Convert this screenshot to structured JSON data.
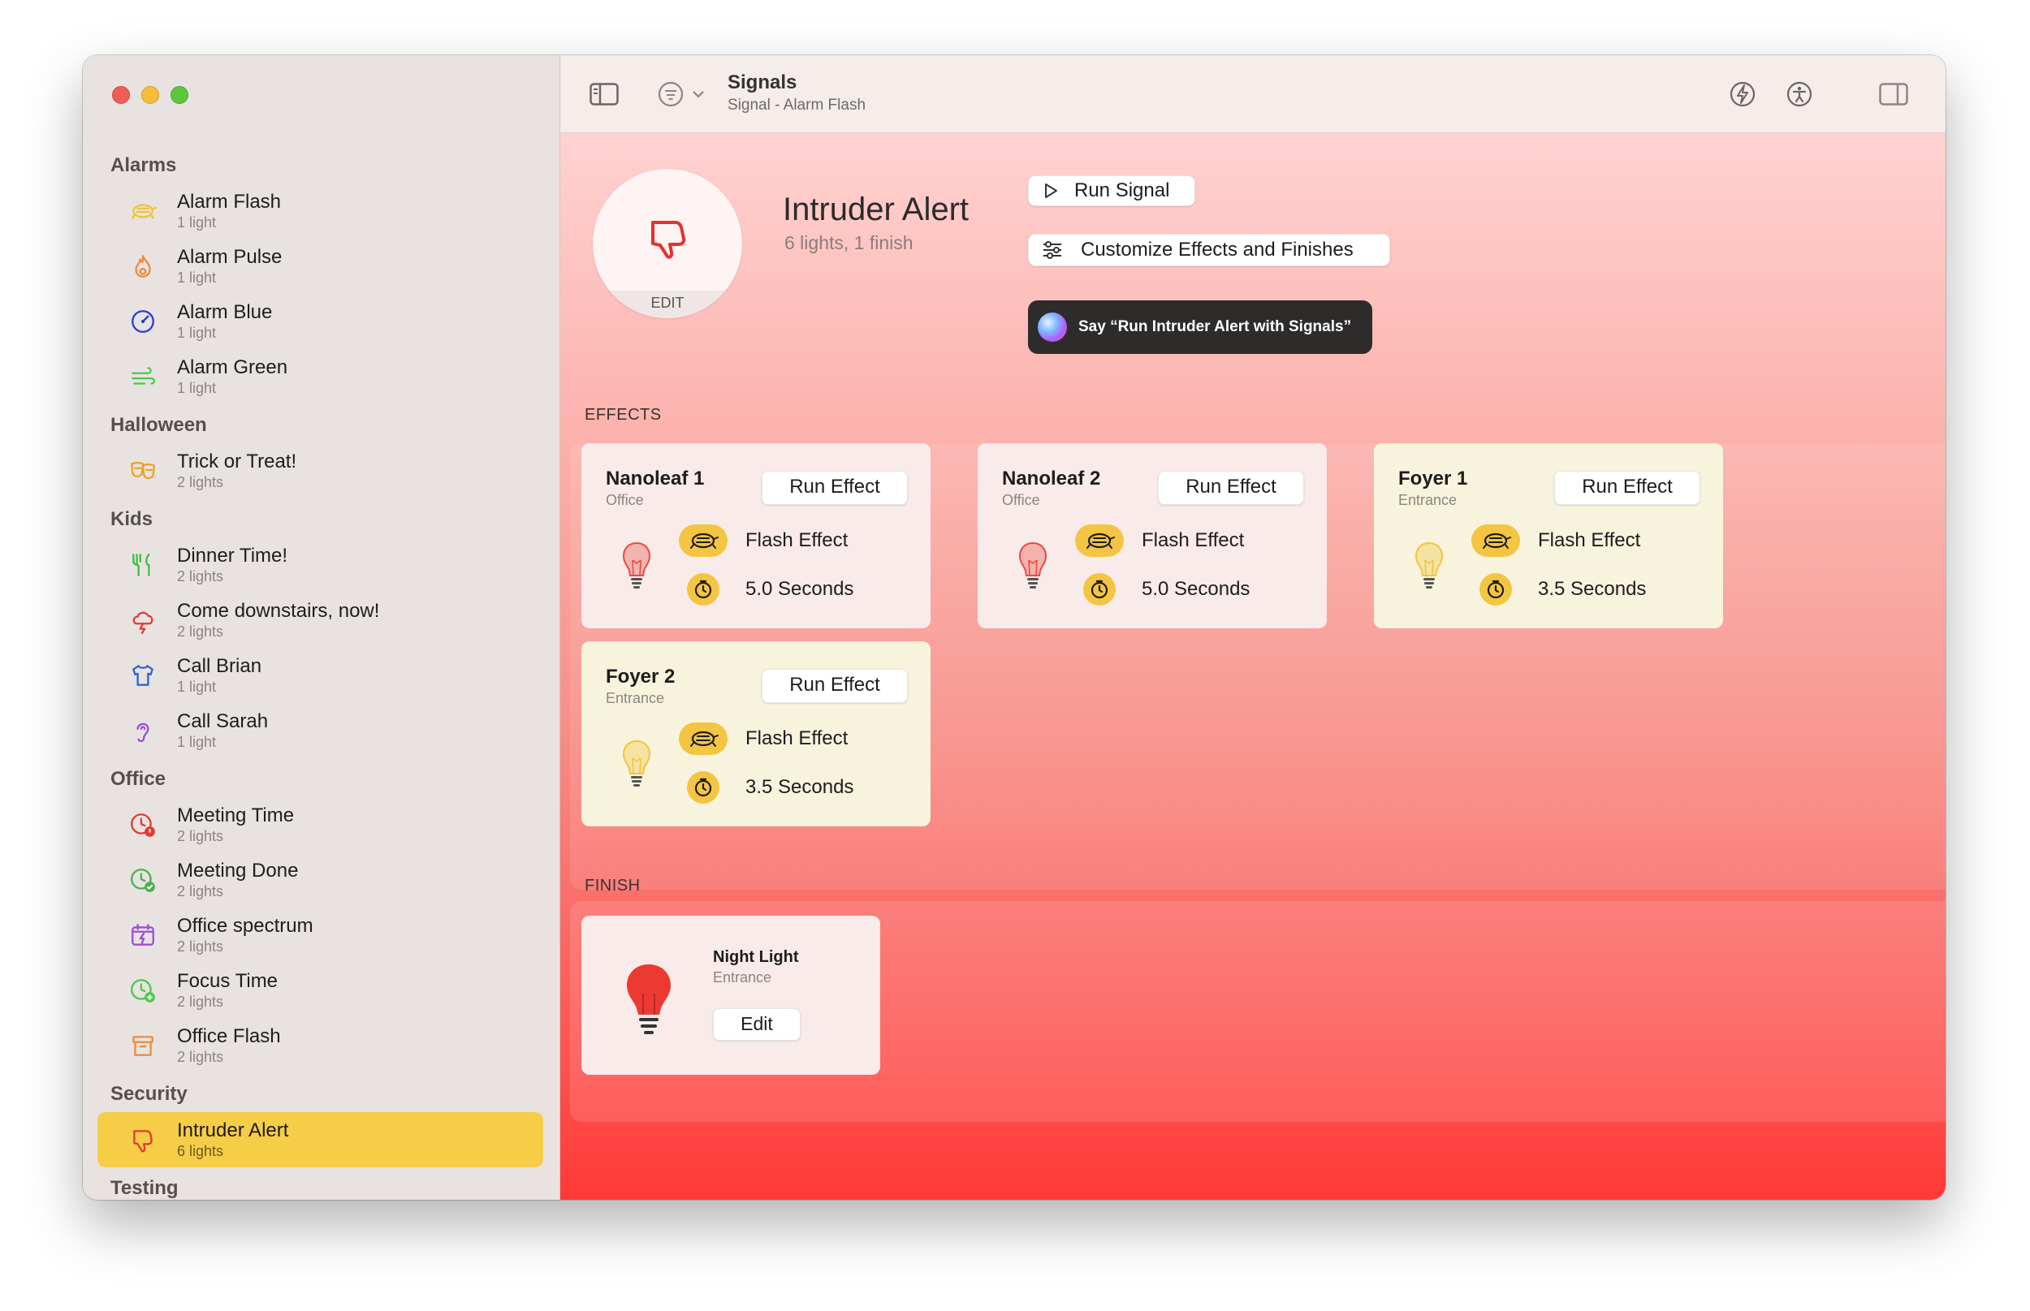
{
  "app": {
    "title": "Signals",
    "subtitle": "Signal - Alarm Flash"
  },
  "sidebar": {
    "groups": [
      {
        "title": "Alarms",
        "items": [
          {
            "name": "Alarm Flash",
            "sub": "1 light",
            "icon": "turtle-icon",
            "color": "#f0c531"
          },
          {
            "name": "Alarm Pulse",
            "sub": "1 light",
            "icon": "flame-icon",
            "color": "#f08a3a"
          },
          {
            "name": "Alarm Blue",
            "sub": "1 light",
            "icon": "gauge-icon",
            "color": "#2a3fd6"
          },
          {
            "name": "Alarm Green",
            "sub": "1 light",
            "icon": "wind-icon",
            "color": "#4cc84a"
          }
        ]
      },
      {
        "title": "Halloween",
        "items": [
          {
            "name": "Trick or Treat!",
            "sub": "2 lights",
            "icon": "theater-masks-icon",
            "color": "#f0a12a"
          }
        ]
      },
      {
        "title": "Kids",
        "items": [
          {
            "name": "Dinner Time!",
            "sub": "2 lights",
            "icon": "fork-knife-icon",
            "color": "#3fbf4a"
          },
          {
            "name": "Come downstairs, now!",
            "sub": "2 lights",
            "icon": "cloud-bolt-icon",
            "color": "#e23b35"
          },
          {
            "name": "Call Brian",
            "sub": "1 light",
            "icon": "tshirt-icon",
            "color": "#2d64d8"
          },
          {
            "name": "Call Sarah",
            "sub": "1 light",
            "icon": "ear-icon",
            "color": "#9b4fd8"
          }
        ]
      },
      {
        "title": "Office",
        "items": [
          {
            "name": "Meeting Time",
            "sub": "2 lights",
            "icon": "clock-alert-icon",
            "color": "#e23b35"
          },
          {
            "name": "Meeting Done",
            "sub": "2 lights",
            "icon": "clock-check-icon",
            "color": "#4caf50"
          },
          {
            "name": "Office spectrum",
            "sub": "2 lights",
            "icon": "calendar-bolt-icon",
            "color": "#9b4fd8"
          },
          {
            "name": "Focus Time",
            "sub": "2 lights",
            "icon": "clock-plus-icon",
            "color": "#4cc84a"
          },
          {
            "name": "Office Flash",
            "sub": "2 lights",
            "icon": "archive-box-icon",
            "color": "#f08a3a"
          }
        ]
      },
      {
        "title": "Security",
        "items": [
          {
            "name": "Intruder Alert",
            "sub": "6 lights",
            "icon": "thumbs-down-icon",
            "color": "#e23b35",
            "selected": true
          }
        ]
      },
      {
        "title": "Testing",
        "items": []
      }
    ]
  },
  "signal": {
    "title": "Intruder Alert",
    "summary": "6 lights, 1 finish",
    "edit_label": "EDIT",
    "run_label": "Run Signal",
    "customize_label": "Customize Effects and Finishes",
    "siri_label": "Say “Run Intruder Alert with Signals”"
  },
  "effects": {
    "label": "EFFECTS",
    "cards": [
      {
        "name": "Nanoleaf 1",
        "room": "Office",
        "run": "Run Effect",
        "effect": "Flash Effect",
        "duration": "5.0 Seconds",
        "bulb_color": "#ec4a43",
        "tone": "red"
      },
      {
        "name": "Nanoleaf 2",
        "room": "Office",
        "run": "Run Effect",
        "effect": "Flash Effect",
        "duration": "5.0 Seconds",
        "bulb_color": "#ec4a43",
        "tone": "red"
      },
      {
        "name": "Foyer 1",
        "room": "Entrance",
        "run": "Run Effect",
        "effect": "Flash Effect",
        "duration": "3.5 Seconds",
        "bulb_color": "#f2c63c",
        "tone": "yellow"
      },
      {
        "name": "Foyer 2",
        "room": "Entrance",
        "run": "Run Effect",
        "effect": "Flash Effect",
        "duration": "3.5 Seconds",
        "bulb_color": "#f2c63c",
        "tone": "yellow"
      }
    ]
  },
  "finish": {
    "label": "FINISH",
    "card": {
      "name": "Night Light",
      "room": "Entrance",
      "edit": "Edit",
      "bulb_color": "#ec3a33"
    }
  }
}
